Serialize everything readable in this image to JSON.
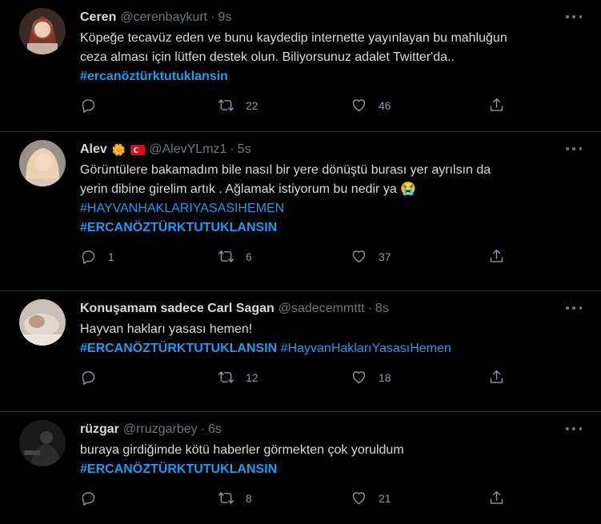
{
  "tweets": [
    {
      "name": "Ceren",
      "handle": "@cerenbaykurt",
      "time": "9s",
      "avatar_icon": "profile-photo-woman-red-hair",
      "lines": [
        "Köpeğe tecavüz eden ve bunu kaydedip internette yayınlayan bu mahluğun",
        "ceza alması için lütfen destek olun. Biliyorsunuz adalet Twitter'da.."
      ],
      "hashtags": [
        "#ercanöztürktutuklansin"
      ],
      "reply_count": "",
      "retweet_count": "22",
      "like_count": "46"
    },
    {
      "name": "Alev",
      "name_emoji": "🌼",
      "flag_icon": "turkey-flag-icon",
      "handle": "@AlevYLmz1",
      "time": "5s",
      "avatar_icon": "profile-photo-woman-blonde",
      "lines": [
        "Görüntülere bakamadım bile nasıl bir yere dönüştü burası yer ayrılsın da",
        "yerin dibine girelim artık . Ağlamak istiyorum bu nedir ya 😭"
      ],
      "hashtags": [
        "#HAYVANHAKLARIYASASIHEMEN",
        "#ERCANÖZTÜRKTUTUKLANSIN"
      ],
      "reply_count": "1",
      "retweet_count": "6",
      "like_count": "37"
    },
    {
      "name": "Konuşamam sadece Carl Sagan",
      "handle": "@sadecemmttt",
      "time": "8s",
      "avatar_icon": "profile-photo-sleeping",
      "lines": [
        "Hayvan hakları yasası hemen!"
      ],
      "hashtags": [
        "#ERCANÖZTÜRKTUTUKLANSIN",
        "#HayvanHaklarıYasasıHemen"
      ],
      "reply_count": "",
      "retweet_count": "12",
      "like_count": "18"
    },
    {
      "name": "rüzgar",
      "handle": "@rruzgarbey",
      "time": "6s",
      "avatar_icon": "profile-photo-dark",
      "lines": [
        "buraya girdiğimde kötü haberler görmekten çok yoruldum"
      ],
      "hashtags": [
        "#ERCANÖZTÜRKTUTUKLANSIN"
      ],
      "reply_count": "",
      "retweet_count": "8",
      "like_count": "21"
    }
  ],
  "colors": {
    "background": "#000000",
    "text": "#d9d9d9",
    "muted": "#6e767d",
    "link": "#1d9bf0",
    "divider": "#2f3336"
  },
  "icons": {
    "more": "more-dots-icon",
    "reply": "reply-icon",
    "retweet": "retweet-icon",
    "like": "heart-icon",
    "share": "share-icon"
  }
}
